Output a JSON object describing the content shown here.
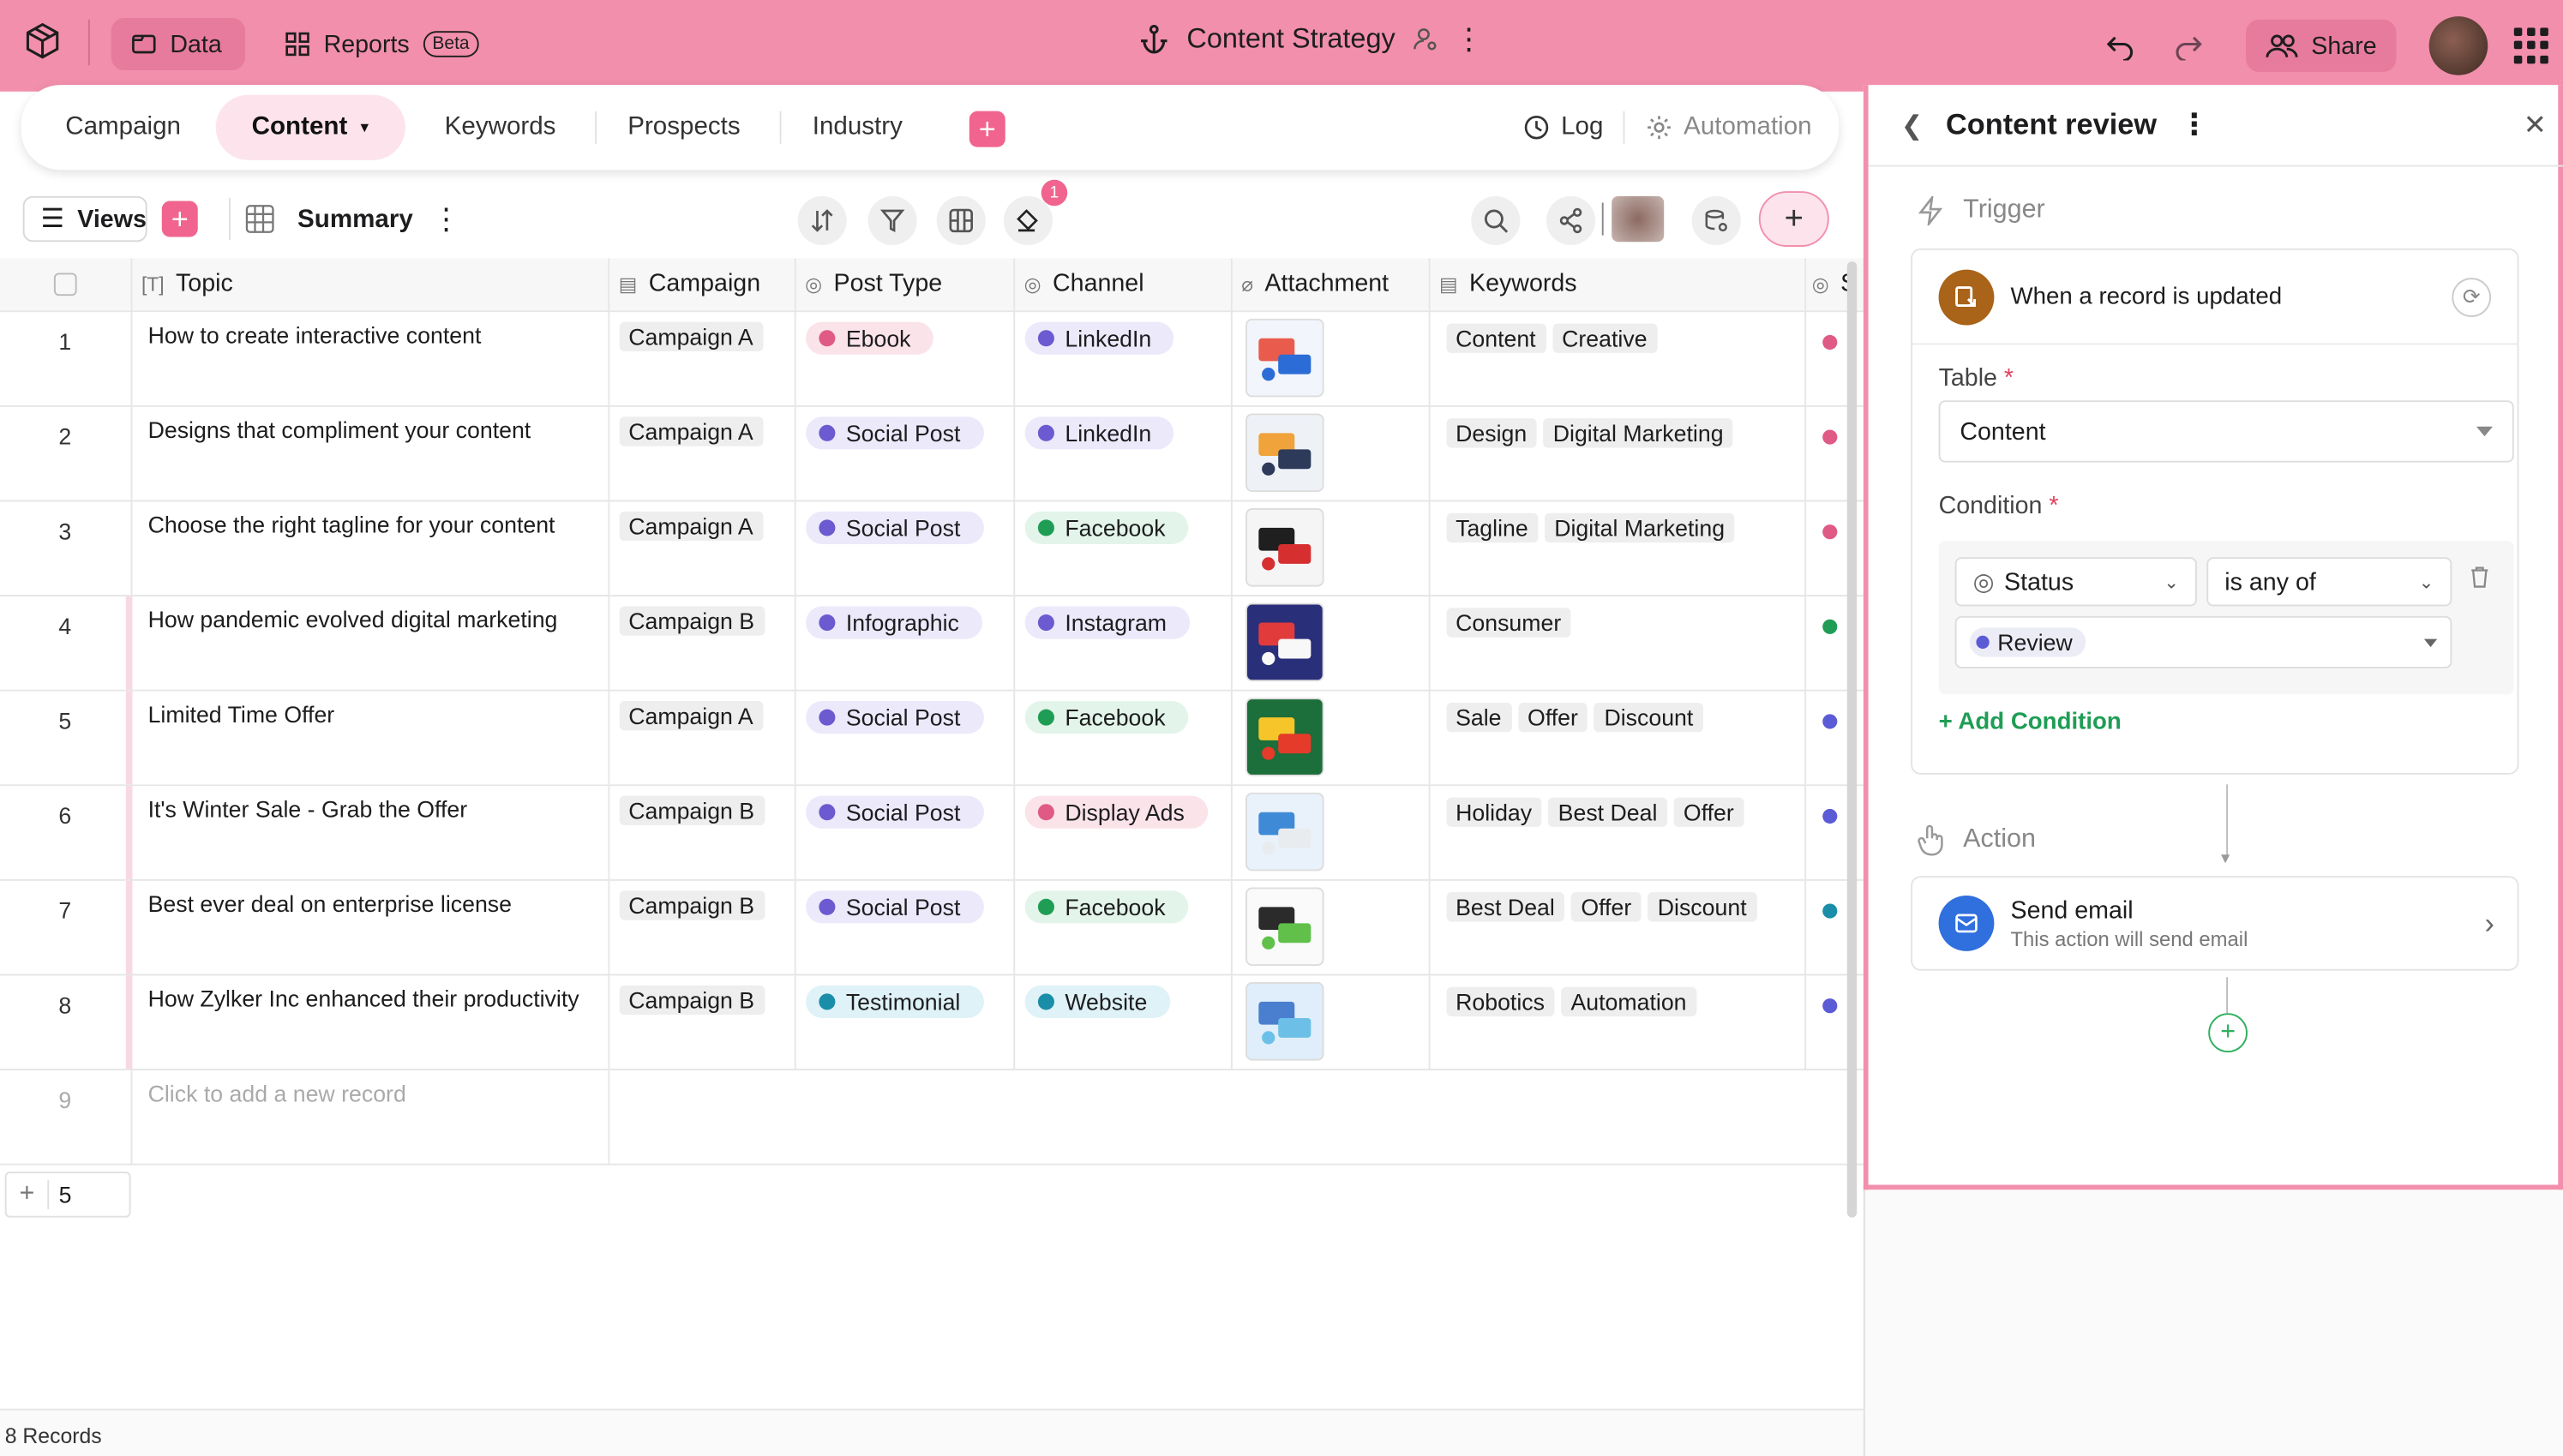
{
  "topbar": {
    "data_label": "Data",
    "reports_label": "Reports",
    "beta_label": "Beta",
    "title": "Content Strategy",
    "share_label": "Share"
  },
  "tabs": [
    {
      "label": "Campaign"
    },
    {
      "label": "Content"
    },
    {
      "label": "Keywords"
    },
    {
      "label": "Prospects"
    },
    {
      "label": "Industry"
    }
  ],
  "tab_actions": {
    "log_label": "Log",
    "automation_label": "Automation"
  },
  "toolbar": {
    "views_label": "Views",
    "view_name": "Summary",
    "badge_count": "1"
  },
  "columns": [
    "Topic",
    "Campaign",
    "Post Type",
    "Channel",
    "Attachment",
    "Keywords",
    "S"
  ],
  "rows": [
    {
      "n": "1",
      "topic": "How to create interactive content",
      "campaign": "Campaign A",
      "post_type": "Ebook",
      "post_color": "#e05a86",
      "post_bg": "#fbe3ea",
      "channel": "LinkedIn",
      "chan_color": "#6b5ad0",
      "chan_bg": "#ece9fb",
      "keywords": [
        "Content",
        "Creative"
      ],
      "status_color": "#e05a86",
      "mark": false
    },
    {
      "n": "2",
      "topic": "Designs that compliment your content",
      "campaign": "Campaign A",
      "post_type": "Social Post",
      "post_color": "#6b5ad0",
      "post_bg": "#ece9fb",
      "channel": "LinkedIn",
      "chan_color": "#6b5ad0",
      "chan_bg": "#ece9fb",
      "keywords": [
        "Design",
        "Digital Marketing"
      ],
      "status_color": "#e05a86",
      "mark": false
    },
    {
      "n": "3",
      "topic": "Choose the right tagline for your content",
      "campaign": "Campaign A",
      "post_type": "Social Post",
      "post_color": "#6b5ad0",
      "post_bg": "#ece9fb",
      "channel": "Facebook",
      "chan_color": "#1f9d55",
      "chan_bg": "#e3f5ea",
      "keywords": [
        "Tagline",
        "Digital Marketing"
      ],
      "status_color": "#e05a86",
      "mark": false
    },
    {
      "n": "4",
      "topic": "How pandemic evolved digital marketing",
      "campaign": "Campaign B",
      "post_type": "Infographic",
      "post_color": "#6b5ad0",
      "post_bg": "#ece9fb",
      "channel": "Instagram",
      "chan_color": "#6b5ad0",
      "chan_bg": "#ece9fb",
      "keywords": [
        "Consumer"
      ],
      "status_color": "#1f9d55",
      "mark": true
    },
    {
      "n": "5",
      "topic": "Limited Time Offer",
      "campaign": "Campaign A",
      "post_type": "Social Post",
      "post_color": "#6b5ad0",
      "post_bg": "#ece9fb",
      "channel": "Facebook",
      "chan_color": "#1f9d55",
      "chan_bg": "#e3f5ea",
      "keywords": [
        "Sale",
        "Offer",
        "Discount"
      ],
      "status_color": "#5b5bd6",
      "mark": true
    },
    {
      "n": "6",
      "topic": "It's Winter Sale - Grab the Offer",
      "campaign": "Campaign B",
      "post_type": "Social Post",
      "post_color": "#6b5ad0",
      "post_bg": "#ece9fb",
      "channel": "Display Ads",
      "chan_color": "#e05a86",
      "chan_bg": "#fbe3ea",
      "keywords": [
        "Holiday",
        "Best Deal",
        "Offer"
      ],
      "status_color": "#5b5bd6",
      "mark": true
    },
    {
      "n": "7",
      "topic": "Best ever deal on enterprise license",
      "campaign": "Campaign B",
      "post_type": "Social Post",
      "post_color": "#6b5ad0",
      "post_bg": "#ece9fb",
      "channel": "Facebook",
      "chan_color": "#1f9d55",
      "chan_bg": "#e3f5ea",
      "keywords": [
        "Best Deal",
        "Offer",
        "Discount"
      ],
      "status_color": "#1a8ea8",
      "mark": true
    },
    {
      "n": "8",
      "topic": "How Zylker Inc enhanced their productivity",
      "campaign": "Campaign B",
      "post_type": "Testimonial",
      "post_color": "#1a8ea8",
      "post_bg": "#dff2f7",
      "channel": "Website",
      "chan_color": "#1a8ea8",
      "chan_bg": "#dff2f7",
      "keywords": [
        "Robotics",
        "Automation"
      ],
      "status_color": "#5b5bd6",
      "mark": true
    }
  ],
  "add_row": {
    "n": "9",
    "placeholder": "Click to add a new record"
  },
  "group_count": "5",
  "footer": {
    "records": "8 Records"
  },
  "panel": {
    "title": "Content review",
    "trigger_label": "Trigger",
    "trigger_text": "When a record is updated",
    "table_label": "Table",
    "required_mark": "*",
    "table_value": "Content",
    "condition_label": "Condition",
    "cond_field": "Status",
    "cond_op": "is any of",
    "cond_value": "Review",
    "add_condition": "+ Add Condition",
    "action_label": "Action",
    "action_title": "Send email",
    "action_desc": "This action will send email"
  }
}
